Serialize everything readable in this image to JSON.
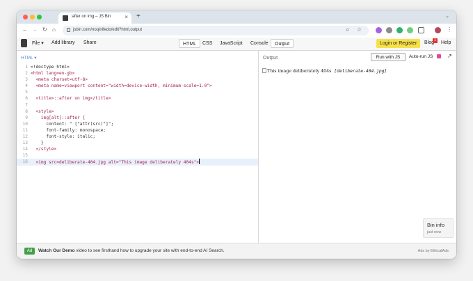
{
  "browser": {
    "tab_title": ":after on img – JS Bin",
    "url": "jsbin.com/noqinifedo/edit?html,output",
    "colors": {
      "red": "#ff5f57",
      "yellow": "#febc2e",
      "green": "#28c840"
    }
  },
  "toolbar": {
    "file_label": "File",
    "add_library_label": "Add library",
    "share_label": "Share",
    "panels": [
      "HTML",
      "CSS",
      "JavaScript",
      "Console",
      "Output"
    ],
    "login_label": "Login or Register",
    "blog_label": "Blog",
    "blog_badge": "1",
    "help_label": "Help"
  },
  "editor": {
    "panel_label": "HTML",
    "lines": [
      "<!doctype html>",
      "<html lang=en-gb>",
      "  <meta charset=utf-8>",
      "  <meta name=viewport content=\"width=device-width, minimum-scale=1.0\">",
      "",
      "  <title>::after on img</title>",
      "",
      "  <style>",
      "    img[alt]::after {",
      "      content: \" [\"attr(src)\"]\";",
      "      font-family: monospace;",
      "      font-style: italic;",
      "    }",
      "  </style>",
      "",
      "  <img src=deliberate-404.jpg alt=\"This image deliberately 404s\">"
    ],
    "active_line": 16
  },
  "output": {
    "label": "Output",
    "run_label": "Run with JS",
    "autorun_label": "Auto-run JS",
    "alt_text": "This image deliberately 404s",
    "after_text": "[deliberate-404.jpg]",
    "bininfo_title": "Bin info",
    "bininfo_sub": "just now"
  },
  "ad": {
    "badge": "Ad",
    "headline": "Watch Our Demo",
    "body": " video to see firsthand how to upgrade your site with end-to-end AI Search.",
    "by": "Ads by EthicalAds"
  }
}
